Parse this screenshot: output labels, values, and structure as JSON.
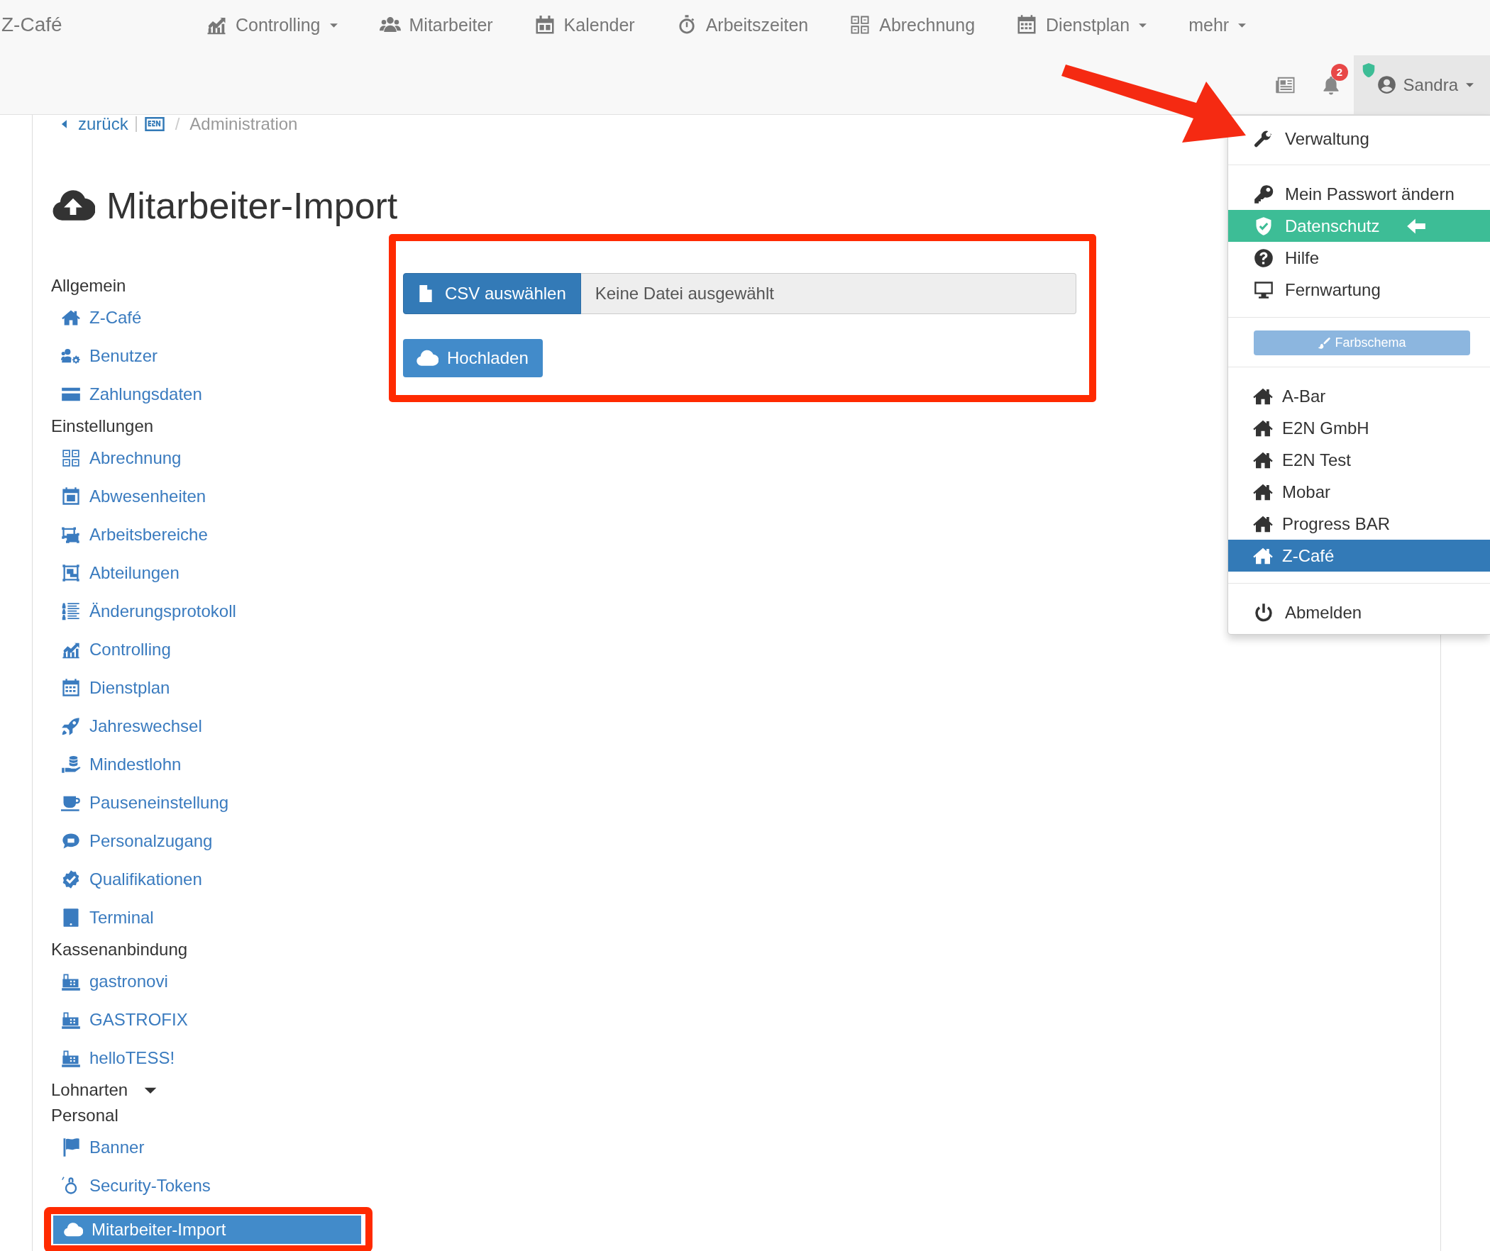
{
  "navbar": {
    "brand": "Z-Café",
    "menu": [
      {
        "label": "Controlling",
        "dropdown": true
      },
      {
        "label": "Mitarbeiter",
        "dropdown": false
      },
      {
        "label": "Kalender",
        "dropdown": false
      },
      {
        "label": "Arbeitszeiten",
        "dropdown": false
      },
      {
        "label": "Abrechnung",
        "dropdown": false
      },
      {
        "label": "Dienstplan",
        "dropdown": true
      },
      {
        "label": "mehr",
        "dropdown": true
      }
    ],
    "notification_count": "2",
    "user": {
      "name": "Sandra",
      "menu_open": true
    }
  },
  "breadcrumb": {
    "back": "zurück",
    "separator": "/",
    "current": "Administration"
  },
  "page_title": "Mitarbeiter-Import",
  "sidebar": {
    "sections": [
      {
        "title": "Allgemein",
        "collapsible": false,
        "items": [
          {
            "label": "Z-Café",
            "selected": false
          },
          {
            "label": "Benutzer",
            "selected": false
          },
          {
            "label": "Zahlungsdaten",
            "selected": false
          }
        ]
      },
      {
        "title": "Einstellungen",
        "collapsible": false,
        "items": [
          {
            "label": "Abrechnung",
            "selected": false
          },
          {
            "label": "Abwesenheiten",
            "selected": false
          },
          {
            "label": "Arbeitsbereiche",
            "selected": false
          },
          {
            "label": "Abteilungen",
            "selected": false
          },
          {
            "label": "Änderungsprotokoll",
            "selected": false
          },
          {
            "label": "Controlling",
            "selected": false
          },
          {
            "label": "Dienstplan",
            "selected": false
          },
          {
            "label": "Jahreswechsel",
            "selected": false
          },
          {
            "label": "Mindestlohn",
            "selected": false
          },
          {
            "label": "Pauseneinstellung",
            "selected": false
          },
          {
            "label": "Personalzugang",
            "selected": false
          },
          {
            "label": "Qualifikationen",
            "selected": false
          },
          {
            "label": "Terminal",
            "selected": false
          }
        ]
      },
      {
        "title": "Kassenanbindung",
        "collapsible": false,
        "items": [
          {
            "label": "gastronovi",
            "selected": false
          },
          {
            "label": "GASTROFIX",
            "selected": false
          },
          {
            "label": "helloTESS!",
            "selected": false
          }
        ]
      },
      {
        "title": "Lohnarten",
        "collapsible": true
      },
      {
        "title": "Personal",
        "collapsible": false,
        "items": [
          {
            "label": "Banner",
            "selected": false
          },
          {
            "label": "Security-Tokens",
            "selected": false
          },
          {
            "label": "Mitarbeiter-Import",
            "selected": true
          }
        ]
      }
    ]
  },
  "upload": {
    "choose_button": "CSV auswählen",
    "file_status": "Keine Datei ausgewählt",
    "upload_button": "Hochladen"
  },
  "user_menu": {
    "admin_item": "Verwaltung",
    "account_items": [
      {
        "label": "Mein Passwort ändern",
        "highlighted": false
      },
      {
        "label": "Datenschutz",
        "highlighted": true
      },
      {
        "label": "Hilfe",
        "highlighted": false
      },
      {
        "label": "Fernwartung",
        "highlighted": false
      }
    ],
    "color_scheme_button": "Farbschema",
    "companies": [
      {
        "label": "A-Bar",
        "selected": false
      },
      {
        "label": "E2N GmbH",
        "selected": false
      },
      {
        "label": "E2N Test",
        "selected": false
      },
      {
        "label": "Mobar",
        "selected": false
      },
      {
        "label": "Progress BAR",
        "selected": false
      },
      {
        "label": "Z-Café",
        "selected": true
      }
    ],
    "logout": "Abmelden"
  }
}
